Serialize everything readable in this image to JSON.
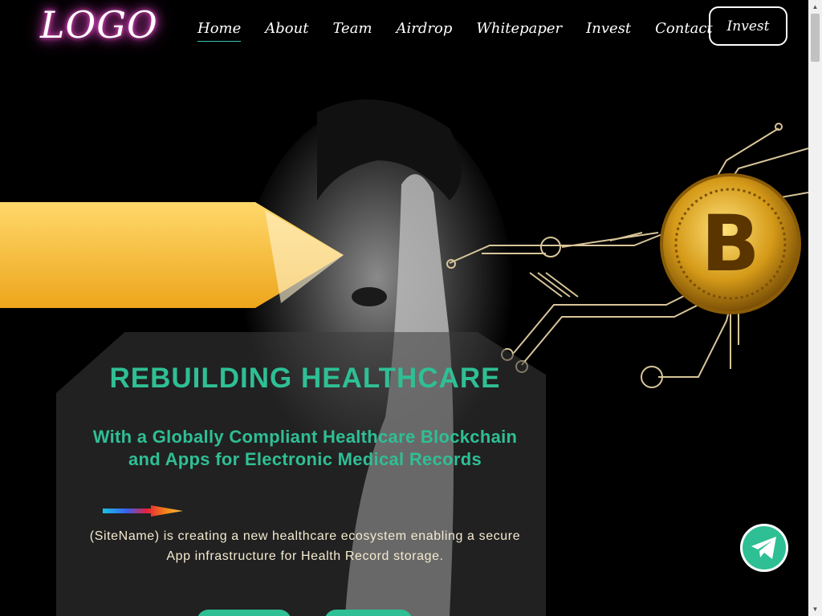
{
  "header": {
    "logo": "LOGO",
    "nav": [
      "Home",
      "About",
      "Team",
      "Airdrop",
      "Whitepaper",
      "Invest",
      "Contact"
    ],
    "active_nav": "Home",
    "cta": "Invest"
  },
  "hero": {
    "headline": "REBUILDING HEALTHCARE",
    "subheadline": "With a Globally Compliant Healthcare Blockchain and Apps for Electronic Medical Records",
    "description": "(SiteName) is creating a new healthcare ecosystem enabling a secure App infrastructure for Health Record storage.",
    "coin_symbol": "B"
  },
  "colors": {
    "accent": "#2fbf94",
    "nav_underline": "#3ac3b3",
    "logo_glow": "#ff4fd8",
    "banner": "#f2b02a",
    "gold": "#d4a020"
  },
  "icons": {
    "floating_button": "telegram-icon"
  }
}
